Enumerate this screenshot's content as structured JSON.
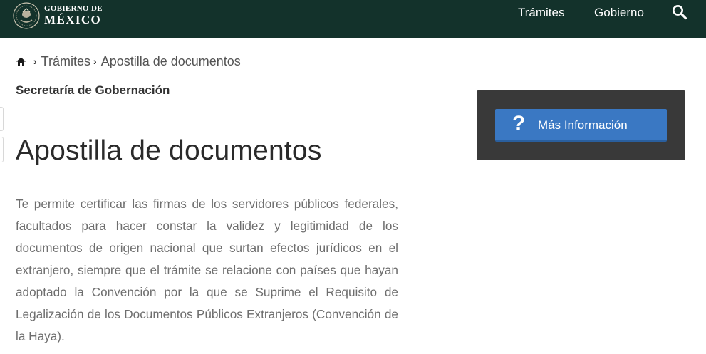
{
  "header": {
    "logo_line1": "GOBIERNO DE",
    "logo_line2": "MÉXICO",
    "nav": [
      "Trámites",
      "Gobierno"
    ],
    "bg_color": "#13322b",
    "search_icon": "search-icon"
  },
  "breadcrumb": {
    "home_icon": "home-icon",
    "items": [
      "Trámites",
      "Apostilla de documentos"
    ]
  },
  "dependency": "Secretaría de Gobernación",
  "title": "Apostilla de documentos",
  "description": "Te permite certificar las firmas de los servidores públicos federales, facultados para hacer constar la validez y legitimidad de los documentos de origen nacional que surtan efectos jurídicos en el extranjero, siempre que el trámite se relacione con países que hayan adoptado la Convención por la que se Suprime el Requisito de Legalización de los Documentos Públicos Extranjeros (Convención de la Haya).",
  "sidebar": {
    "button_icon": "?",
    "button_label": "Más Información",
    "panel_color": "#393939",
    "button_color": "#3a78c3"
  }
}
